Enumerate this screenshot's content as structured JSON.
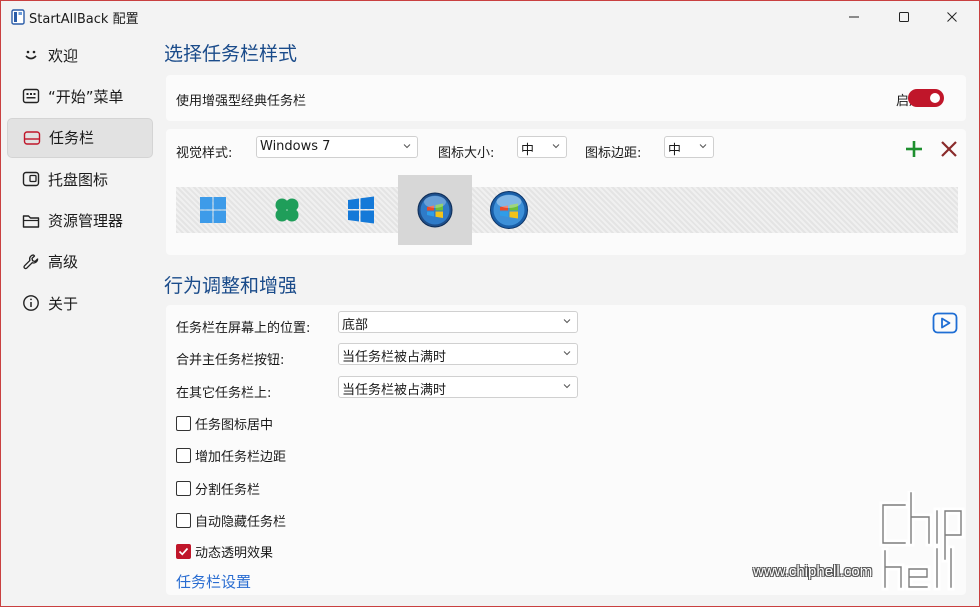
{
  "window": {
    "title": "StartAllBack 配置"
  },
  "sidebar": {
    "items": [
      {
        "label": "欢迎",
        "icon": "smiley-icon",
        "active": false
      },
      {
        "label": "“开始”菜单",
        "icon": "start-menu-icon",
        "active": false
      },
      {
        "label": "任务栏",
        "icon": "taskbar-icon",
        "active": true
      },
      {
        "label": "托盘图标",
        "icon": "tray-icon",
        "active": false
      },
      {
        "label": "资源管理器",
        "icon": "folder-icon",
        "active": false
      },
      {
        "label": "高级",
        "icon": "wrench-icon",
        "active": false
      },
      {
        "label": "关于",
        "icon": "info-icon",
        "active": false
      }
    ]
  },
  "style_section": {
    "title": "选择任务栏样式",
    "enhanced_label": "使用增强型经典任务栏",
    "enable_label": "启用",
    "enabled": true,
    "visual_style_label": "视觉样式:",
    "visual_style_value": "Windows 7",
    "icon_size_label": "图标大小:",
    "icon_size_value": "中",
    "icon_margin_label": "图标边距:",
    "icon_margin_value": "中",
    "styles": [
      "win11-logo-icon",
      "clover-logo-icon",
      "win10-logo-icon",
      "win7-orb-icon",
      "vista-orb-icon"
    ],
    "selected_style_index": 3
  },
  "behavior_section": {
    "title": "行为调整和增强",
    "position_label": "任务栏在屏幕上的位置:",
    "position_value": "底部",
    "combine_label": "合并主任务栏按钮:",
    "combine_value": "当任务栏被占满时",
    "other_label": "在其它任务栏上:",
    "other_value": "当任务栏被占满时",
    "checkboxes": [
      {
        "label": "任务图标居中",
        "checked": false
      },
      {
        "label": "增加任务栏边距",
        "checked": false
      },
      {
        "label": "分割任务栏",
        "checked": false
      },
      {
        "label": "自动隐藏任务栏",
        "checked": false
      },
      {
        "label": "动态透明效果",
        "checked": true
      }
    ],
    "settings_link": "任务栏设置"
  },
  "watermark": {
    "site": "www.chiphell.com",
    "logo": "chip hell"
  },
  "colors": {
    "accent": "#c0162a",
    "heading": "#1a4b8a",
    "link": "#2a6dd1",
    "add": "#1e8f2e",
    "remove": "#8a2a2a"
  }
}
